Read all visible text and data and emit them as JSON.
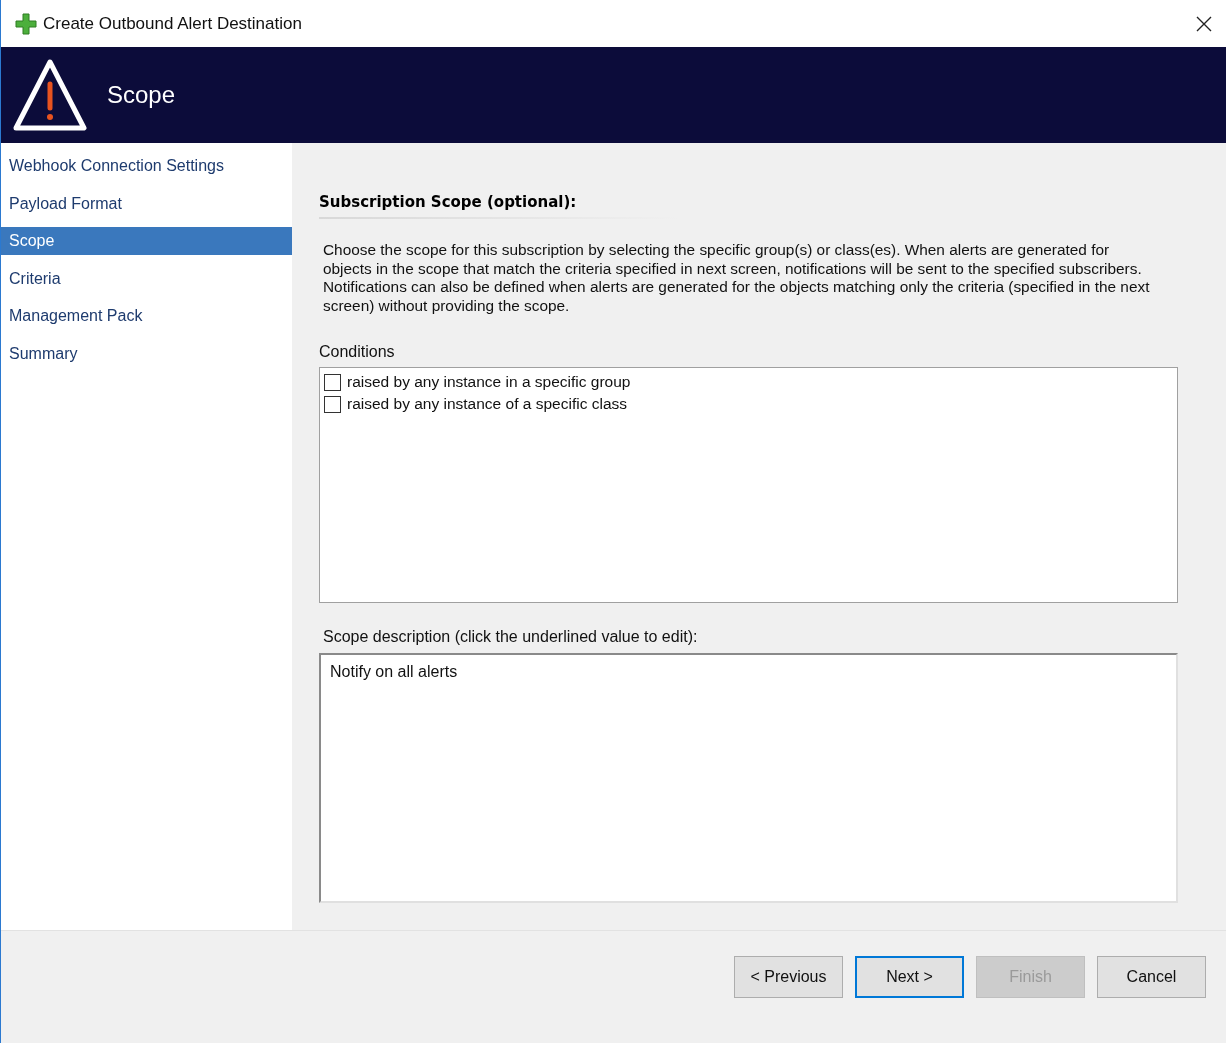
{
  "window": {
    "title": "Create Outbound Alert Destination"
  },
  "header": {
    "title": "Scope"
  },
  "steps": [
    {
      "label": "Webhook Connection Settings",
      "selected": false
    },
    {
      "label": "Payload Format",
      "selected": false
    },
    {
      "label": "Scope",
      "selected": true
    },
    {
      "label": "Criteria",
      "selected": false
    },
    {
      "label": "Management Pack",
      "selected": false
    },
    {
      "label": "Summary",
      "selected": false
    }
  ],
  "section_heading": "Subscription Scope (optional):",
  "instructions": "Choose the scope for this subscription by selecting the specific group(s) or class(es). When alerts are generated for objects in the scope that match the criteria specified in next screen, notifications will be sent to the specified subscribers. Notifications can also be defined when alerts are generated for the objects matching only the criteria (specified in the next screen) without providing the scope.",
  "conditions": {
    "label": "Conditions",
    "items": [
      {
        "label": "raised by any instance in a specific group",
        "checked": false
      },
      {
        "label": "raised by any instance of a specific class",
        "checked": false
      }
    ]
  },
  "scope_description": {
    "label": "Scope description (click the underlined value to edit):",
    "value": "Notify on all alerts"
  },
  "buttons": [
    {
      "label": "< Previous",
      "disabled": false,
      "default": false
    },
    {
      "label": "Next >",
      "disabled": false,
      "default": true
    },
    {
      "label": "Finish",
      "disabled": true,
      "default": false
    },
    {
      "label": "Cancel",
      "disabled": false,
      "default": false
    }
  ]
}
